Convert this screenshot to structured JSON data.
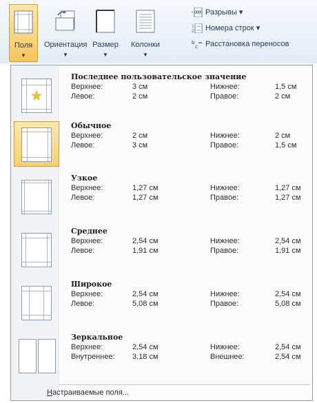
{
  "ribbon": {
    "buttons": [
      {
        "label": "Поля",
        "icon": "margins-icon",
        "active": true
      },
      {
        "label": "Ориентация",
        "icon": "orientation-icon"
      },
      {
        "label": "Размер",
        "icon": "size-icon"
      },
      {
        "label": "Колонки",
        "icon": "columns-icon"
      }
    ],
    "small_commands": [
      {
        "label": "Разрывы",
        "icon": "breaks-icon"
      },
      {
        "label": "Номера строк",
        "icon": "line-numbers-icon"
      },
      {
        "label": "Расстановка переносов",
        "icon": "hyphenation-icon"
      }
    ]
  },
  "menu": {
    "items": [
      {
        "title": "Последнее пользовательское значение",
        "icon": "star-icon",
        "top_label": "Верхнее:",
        "top_value": "3 см",
        "bottom_label": "Нижнее:",
        "bottom_value": "1,5 см",
        "left_label": "Левое:",
        "left_value": "2 см",
        "right_label": "Правое:",
        "right_value": "2 см"
      },
      {
        "title": "Обычное",
        "icon": "normal-margins-icon",
        "selected": true,
        "top_label": "Верхнее:",
        "top_value": "2 см",
        "bottom_label": "Нижнее:",
        "bottom_value": "2 см",
        "left_label": "Левое:",
        "left_value": "3 см",
        "right_label": "Правое:",
        "right_value": "1,5 см"
      },
      {
        "title": "Узкое",
        "icon": "narrow-margins-icon",
        "top_label": "Верхнее:",
        "top_value": "1,27 см",
        "bottom_label": "Нижнее:",
        "bottom_value": "1,27 см",
        "left_label": "Левое:",
        "left_value": "1,27 см",
        "right_label": "Правое:",
        "right_value": "1,27 см"
      },
      {
        "title": "Среднее",
        "icon": "moderate-margins-icon",
        "top_label": "Верхнее:",
        "top_value": "2,54 см",
        "bottom_label": "Нижнее:",
        "bottom_value": "2,54 см",
        "left_label": "Левое:",
        "left_value": "1,91 см",
        "right_label": "Правое:",
        "right_value": "1,91 см"
      },
      {
        "title": "Широкое",
        "icon": "wide-margins-icon",
        "top_label": "Верхнее:",
        "top_value": "2,54 см",
        "bottom_label": "Нижнее:",
        "bottom_value": "2,54 см",
        "left_label": "Левое:",
        "left_value": "5,08 см",
        "right_label": "Правое:",
        "right_value": "5,08 см"
      },
      {
        "title": "Зеркальное",
        "icon": "mirrored-margins-icon",
        "top_label": "Верхнее:",
        "top_value": "2,54 см",
        "bottom_label": "Нижнее:",
        "bottom_value": "2,54 см",
        "left_label": "Внутреннее:",
        "left_value": "3,18 см",
        "right_label": "Внешнее:",
        "right_value": "2,54 см"
      }
    ],
    "footer": {
      "accel": "Н",
      "rest": "астраиваемые поля..."
    }
  }
}
